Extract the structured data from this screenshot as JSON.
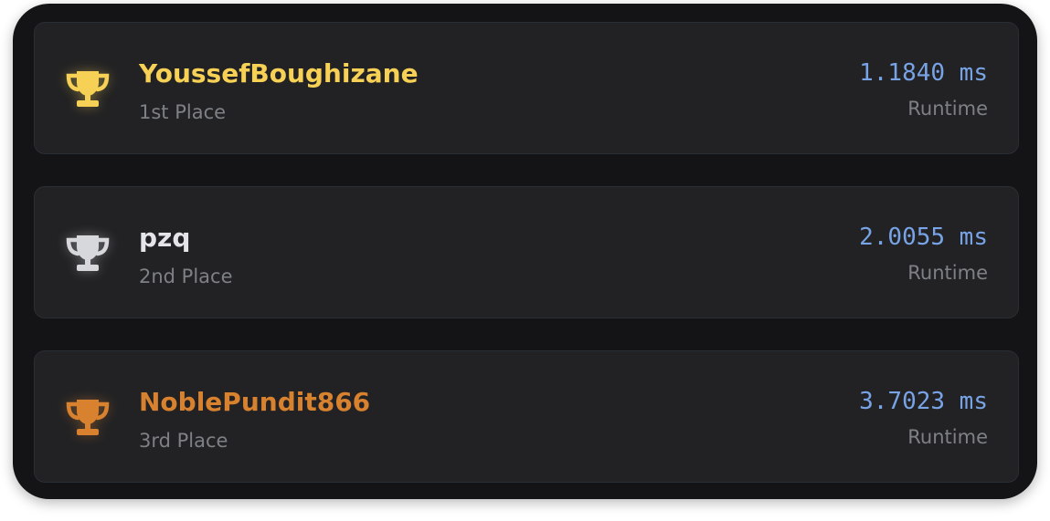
{
  "leaderboard": {
    "entries": [
      {
        "name": "YoussefBoughizane",
        "place": "1st Place",
        "runtime": "1.1840 ms",
        "runtime_label": "Runtime",
        "icon": "trophy-icon",
        "color": "#f6d155"
      },
      {
        "name": "pzq",
        "place": "2nd Place",
        "runtime": "2.0055 ms",
        "runtime_label": "Runtime",
        "icon": "trophy-icon",
        "color": "#d7d8db"
      },
      {
        "name": "NoblePundit866",
        "place": "3rd Place",
        "runtime": "3.7023 ms",
        "runtime_label": "Runtime",
        "icon": "trophy-icon",
        "color": "#d8822f"
      }
    ]
  },
  "colors": {
    "runtime_accent": "#78a3e6",
    "muted_text": "#7d8186",
    "panel_bg": "#141416",
    "card_bg": "#222224"
  }
}
